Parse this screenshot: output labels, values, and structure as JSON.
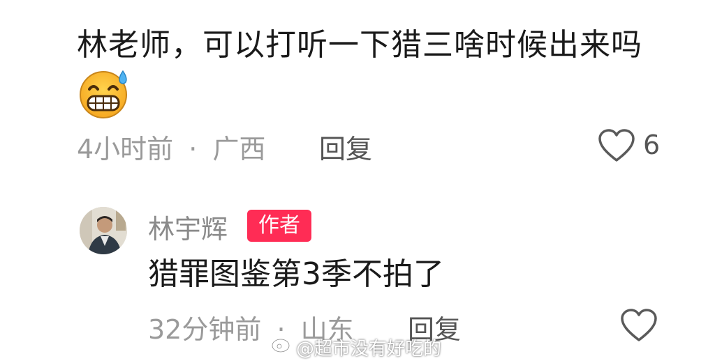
{
  "comment": {
    "text": "林老师，可以打听一下猎三啥时候出来吗",
    "emoji": "grinning-sweat-emoji",
    "time": "4小时前",
    "separator": "·",
    "location": "广西",
    "reply_label": "回复",
    "likes": "6"
  },
  "reply": {
    "author": "林宇辉",
    "badge": "作者",
    "text": "猎罪图鉴第3季不拍了",
    "time": "32分钟前",
    "separator": "·",
    "location": "山东",
    "reply_label": "回复"
  },
  "watermark": {
    "text": "@超市没有好吃的"
  },
  "colors": {
    "badge": "#ff2c55",
    "meta": "#9a9a9a",
    "text": "#1a1a1a"
  }
}
